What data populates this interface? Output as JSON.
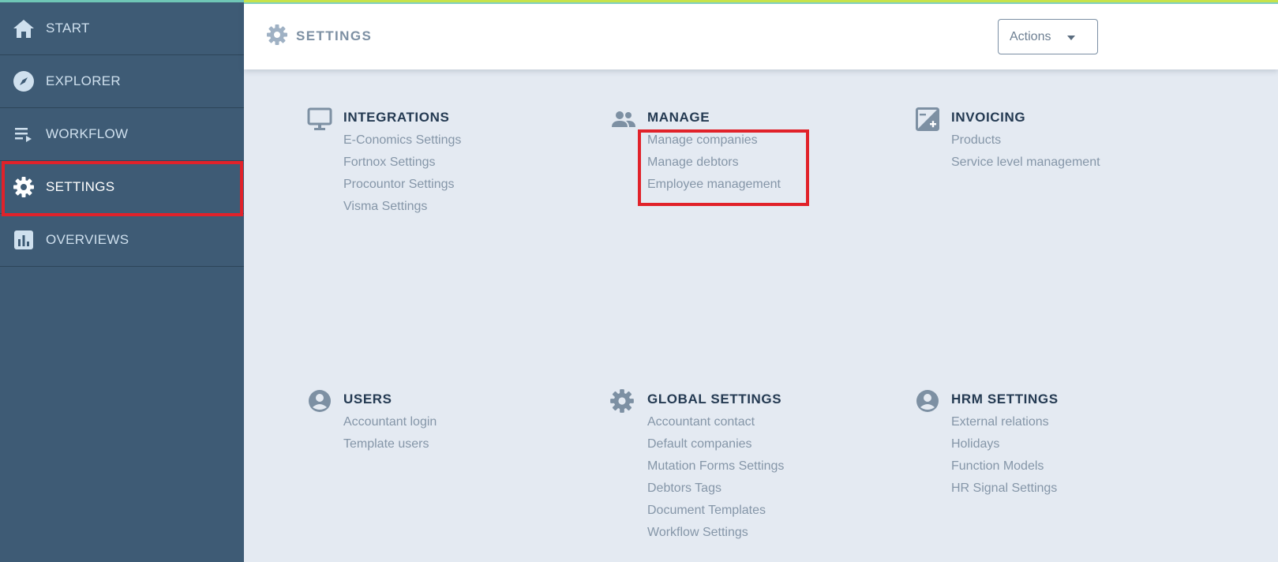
{
  "sidebar": {
    "items": [
      {
        "label": "START",
        "icon": "home-icon"
      },
      {
        "label": "EXPLORER",
        "icon": "compass-icon"
      },
      {
        "label": "WORKFLOW",
        "icon": "workflow-icon"
      },
      {
        "label": "SETTINGS",
        "icon": "gear-icon",
        "active": true
      },
      {
        "label": "OVERVIEWS",
        "icon": "bar-chart-icon"
      }
    ]
  },
  "header": {
    "title": "SETTINGS",
    "actions_label": "Actions"
  },
  "sections": {
    "integrations": {
      "title": "INTEGRATIONS",
      "icon": "monitor-icon",
      "links": [
        "E-Conomics Settings",
        "Fortnox Settings",
        "Procountor Settings",
        "Visma Settings"
      ]
    },
    "manage": {
      "title": "MANAGE",
      "icon": "people-icon",
      "links": [
        "Manage companies",
        "Manage debtors",
        "Employee management"
      ]
    },
    "invoicing": {
      "title": "INVOICING",
      "icon": "invoice-icon",
      "links": [
        "Products",
        "Service level management"
      ]
    },
    "users": {
      "title": "USERS",
      "icon": "user-circle-icon",
      "links": [
        "Accountant login",
        "Template users"
      ]
    },
    "global": {
      "title": "GLOBAL SETTINGS",
      "icon": "gear-icon",
      "links": [
        "Accountant contact",
        "Default companies",
        "Mutation Forms Settings",
        "Debtors Tags",
        "Document Templates",
        "Workflow Settings"
      ]
    },
    "hrm": {
      "title": "HRM SETTINGS",
      "icon": "user-circle-icon",
      "links": [
        "External relations",
        "Holidays",
        "Function Models",
        "HR Signal Settings"
      ]
    }
  },
  "colors": {
    "sidebar_bg": "#3e5b75",
    "content_bg": "#e4eaf2",
    "highlight": "#e1222a",
    "heading": "#243a52",
    "link": "#8596a8"
  }
}
